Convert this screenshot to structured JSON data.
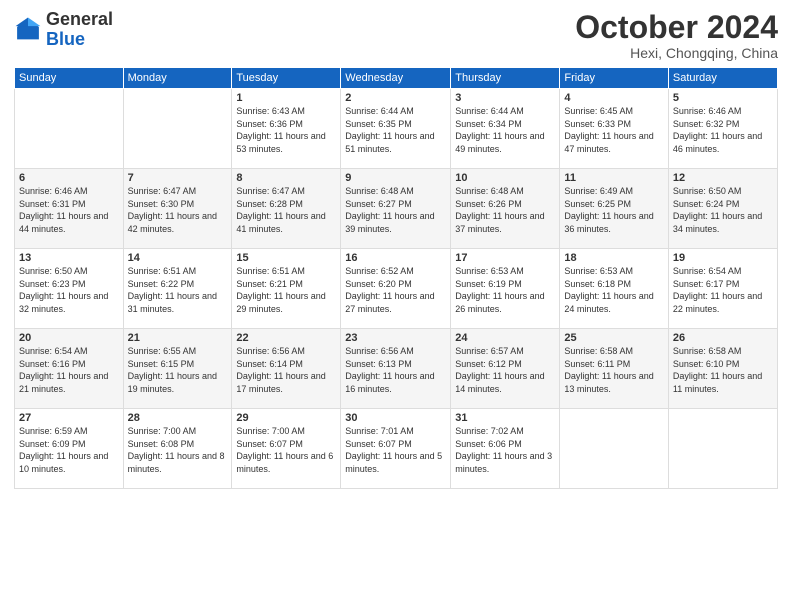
{
  "header": {
    "logo_general": "General",
    "logo_blue": "Blue",
    "month_year": "October 2024",
    "location": "Hexi, Chongqing, China"
  },
  "weekdays": [
    "Sunday",
    "Monday",
    "Tuesday",
    "Wednesday",
    "Thursday",
    "Friday",
    "Saturday"
  ],
  "weeks": [
    [
      {
        "day": "",
        "info": ""
      },
      {
        "day": "",
        "info": ""
      },
      {
        "day": "1",
        "info": "Sunrise: 6:43 AM\nSunset: 6:36 PM\nDaylight: 11 hours and 53 minutes."
      },
      {
        "day": "2",
        "info": "Sunrise: 6:44 AM\nSunset: 6:35 PM\nDaylight: 11 hours and 51 minutes."
      },
      {
        "day": "3",
        "info": "Sunrise: 6:44 AM\nSunset: 6:34 PM\nDaylight: 11 hours and 49 minutes."
      },
      {
        "day": "4",
        "info": "Sunrise: 6:45 AM\nSunset: 6:33 PM\nDaylight: 11 hours and 47 minutes."
      },
      {
        "day": "5",
        "info": "Sunrise: 6:46 AM\nSunset: 6:32 PM\nDaylight: 11 hours and 46 minutes."
      }
    ],
    [
      {
        "day": "6",
        "info": "Sunrise: 6:46 AM\nSunset: 6:31 PM\nDaylight: 11 hours and 44 minutes."
      },
      {
        "day": "7",
        "info": "Sunrise: 6:47 AM\nSunset: 6:30 PM\nDaylight: 11 hours and 42 minutes."
      },
      {
        "day": "8",
        "info": "Sunrise: 6:47 AM\nSunset: 6:28 PM\nDaylight: 11 hours and 41 minutes."
      },
      {
        "day": "9",
        "info": "Sunrise: 6:48 AM\nSunset: 6:27 PM\nDaylight: 11 hours and 39 minutes."
      },
      {
        "day": "10",
        "info": "Sunrise: 6:48 AM\nSunset: 6:26 PM\nDaylight: 11 hours and 37 minutes."
      },
      {
        "day": "11",
        "info": "Sunrise: 6:49 AM\nSunset: 6:25 PM\nDaylight: 11 hours and 36 minutes."
      },
      {
        "day": "12",
        "info": "Sunrise: 6:50 AM\nSunset: 6:24 PM\nDaylight: 11 hours and 34 minutes."
      }
    ],
    [
      {
        "day": "13",
        "info": "Sunrise: 6:50 AM\nSunset: 6:23 PM\nDaylight: 11 hours and 32 minutes."
      },
      {
        "day": "14",
        "info": "Sunrise: 6:51 AM\nSunset: 6:22 PM\nDaylight: 11 hours and 31 minutes."
      },
      {
        "day": "15",
        "info": "Sunrise: 6:51 AM\nSunset: 6:21 PM\nDaylight: 11 hours and 29 minutes."
      },
      {
        "day": "16",
        "info": "Sunrise: 6:52 AM\nSunset: 6:20 PM\nDaylight: 11 hours and 27 minutes."
      },
      {
        "day": "17",
        "info": "Sunrise: 6:53 AM\nSunset: 6:19 PM\nDaylight: 11 hours and 26 minutes."
      },
      {
        "day": "18",
        "info": "Sunrise: 6:53 AM\nSunset: 6:18 PM\nDaylight: 11 hours and 24 minutes."
      },
      {
        "day": "19",
        "info": "Sunrise: 6:54 AM\nSunset: 6:17 PM\nDaylight: 11 hours and 22 minutes."
      }
    ],
    [
      {
        "day": "20",
        "info": "Sunrise: 6:54 AM\nSunset: 6:16 PM\nDaylight: 11 hours and 21 minutes."
      },
      {
        "day": "21",
        "info": "Sunrise: 6:55 AM\nSunset: 6:15 PM\nDaylight: 11 hours and 19 minutes."
      },
      {
        "day": "22",
        "info": "Sunrise: 6:56 AM\nSunset: 6:14 PM\nDaylight: 11 hours and 17 minutes."
      },
      {
        "day": "23",
        "info": "Sunrise: 6:56 AM\nSunset: 6:13 PM\nDaylight: 11 hours and 16 minutes."
      },
      {
        "day": "24",
        "info": "Sunrise: 6:57 AM\nSunset: 6:12 PM\nDaylight: 11 hours and 14 minutes."
      },
      {
        "day": "25",
        "info": "Sunrise: 6:58 AM\nSunset: 6:11 PM\nDaylight: 11 hours and 13 minutes."
      },
      {
        "day": "26",
        "info": "Sunrise: 6:58 AM\nSunset: 6:10 PM\nDaylight: 11 hours and 11 minutes."
      }
    ],
    [
      {
        "day": "27",
        "info": "Sunrise: 6:59 AM\nSunset: 6:09 PM\nDaylight: 11 hours and 10 minutes."
      },
      {
        "day": "28",
        "info": "Sunrise: 7:00 AM\nSunset: 6:08 PM\nDaylight: 11 hours and 8 minutes."
      },
      {
        "day": "29",
        "info": "Sunrise: 7:00 AM\nSunset: 6:07 PM\nDaylight: 11 hours and 6 minutes."
      },
      {
        "day": "30",
        "info": "Sunrise: 7:01 AM\nSunset: 6:07 PM\nDaylight: 11 hours and 5 minutes."
      },
      {
        "day": "31",
        "info": "Sunrise: 7:02 AM\nSunset: 6:06 PM\nDaylight: 11 hours and 3 minutes."
      },
      {
        "day": "",
        "info": ""
      },
      {
        "day": "",
        "info": ""
      }
    ]
  ]
}
